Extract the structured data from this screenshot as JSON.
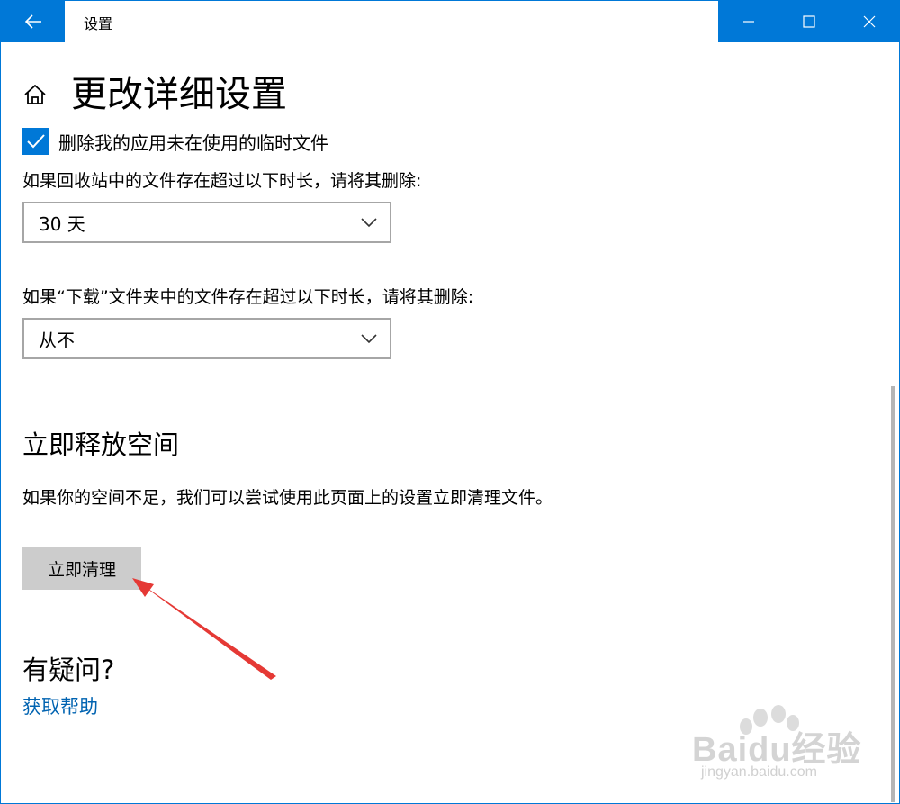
{
  "window": {
    "title": "设置",
    "back_icon": "back-arrow-icon",
    "controls": [
      "minimize-icon",
      "maximize-icon",
      "close-icon"
    ],
    "accent_color": "#0078d7"
  },
  "page": {
    "title": "更改详细设置",
    "home_icon": "home-icon"
  },
  "temp_files": {
    "checked": true,
    "label": "删除我的应用未在使用的临时文件"
  },
  "recycle_bin": {
    "label": "如果回收站中的文件存在超过以下时长，请将其删除:",
    "selected": "30 天"
  },
  "downloads": {
    "label": "如果“下载”文件夹中的文件存在超过以下时长，请将其删除:",
    "selected": "从不"
  },
  "free_space": {
    "heading": "立即释放空间",
    "description": "如果你的空间不足，我们可以尝试使用此页面上的设置立即清理文件。",
    "button_label": "立即清理"
  },
  "help": {
    "heading": "有疑问?",
    "link_text": "获取帮助",
    "link_color": "#0063b1"
  },
  "watermark": {
    "main_text": "Baidu经验",
    "sub_text": "jingyan.baidu.com"
  },
  "annotation": {
    "arrow_color": "#e53935"
  }
}
